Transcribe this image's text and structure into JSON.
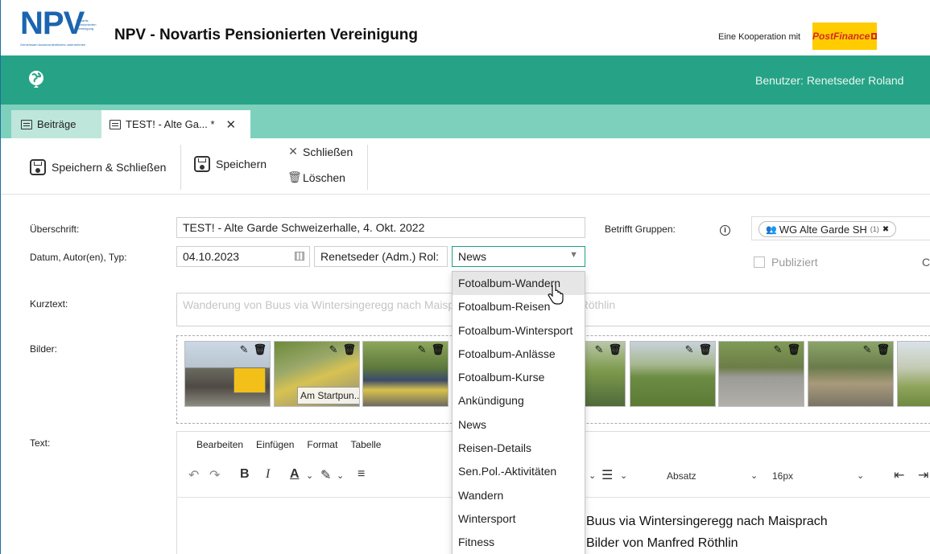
{
  "header": {
    "logo_text": "NPV",
    "logo_subtext": "Novartis Pensionierten Vereinigung",
    "logo_tagline": "Gemeinsam Ausserordentliches unternehmen",
    "app_title": "NPV - Novartis Pensionierten Vereinigung",
    "cooperation_label": "Eine Kooperation mit",
    "partner_name": "PostFinance"
  },
  "band": {
    "user_label": "Benutzer: Renetseder Roland"
  },
  "tabs": [
    {
      "label": "Beiträge"
    },
    {
      "label": "TEST! - Alte Ga... *"
    }
  ],
  "toolbar": {
    "save_close_label": "Speichern & Schließen",
    "save_label": "Speichern",
    "close_label": "Schließen",
    "delete_label": "Löschen"
  },
  "form": {
    "heading_label": "Überschrift:",
    "heading_value": "TEST! - Alte Garde Schweizerhalle, 4. Okt. 2022",
    "groups_label": "Betrifft Gruppen:",
    "group_chip": "WG Alte Garde SH",
    "group_chip_count": "(1)",
    "meta_label": "Datum, Autor(en), Typ:",
    "date_value": "04.10.2023",
    "author_value": "Renetseder (Adm.) Rol:",
    "type_value": "News",
    "published_label": "Publiziert",
    "right_edge_char": "C",
    "short_text_label": "Kurztext:",
    "short_text_placeholder": "Wanderung von Buus via Wintersingeregg nach Maisprach, Bilder von Manfred Röthlin",
    "images_label": "Bilder:",
    "image_caption": "Am Startpun...",
    "text_label": "Text:"
  },
  "editor": {
    "menu": [
      "Bearbeiten",
      "Einfügen",
      "Format",
      "Tabelle"
    ],
    "block_format": "Absatz",
    "font_size": "16px",
    "line1": "Buus via Wintersingeregg nach Maisprach",
    "line2": "Bilder von Manfred Röthlin"
  },
  "dropdown": {
    "options": [
      "Fotoalbum-Wandern",
      "Fotoalbum-Reisen",
      "Fotoalbum-Wintersport",
      "Fotoalbum-Anlässe",
      "Fotoalbum-Kurse",
      "Ankündigung",
      "News",
      "Reisen-Details",
      "Sen.Pol.-Aktivitäten",
      "Wandern",
      "Wintersport",
      "Fitness"
    ],
    "highlighted": "Fotoalbum-Wandern"
  },
  "colors": {
    "brand_blue": "#1b65b0",
    "band_green": "#26a386",
    "tab_strip": "#7dd1bc",
    "postfinance_yellow": "#ffcc00"
  }
}
